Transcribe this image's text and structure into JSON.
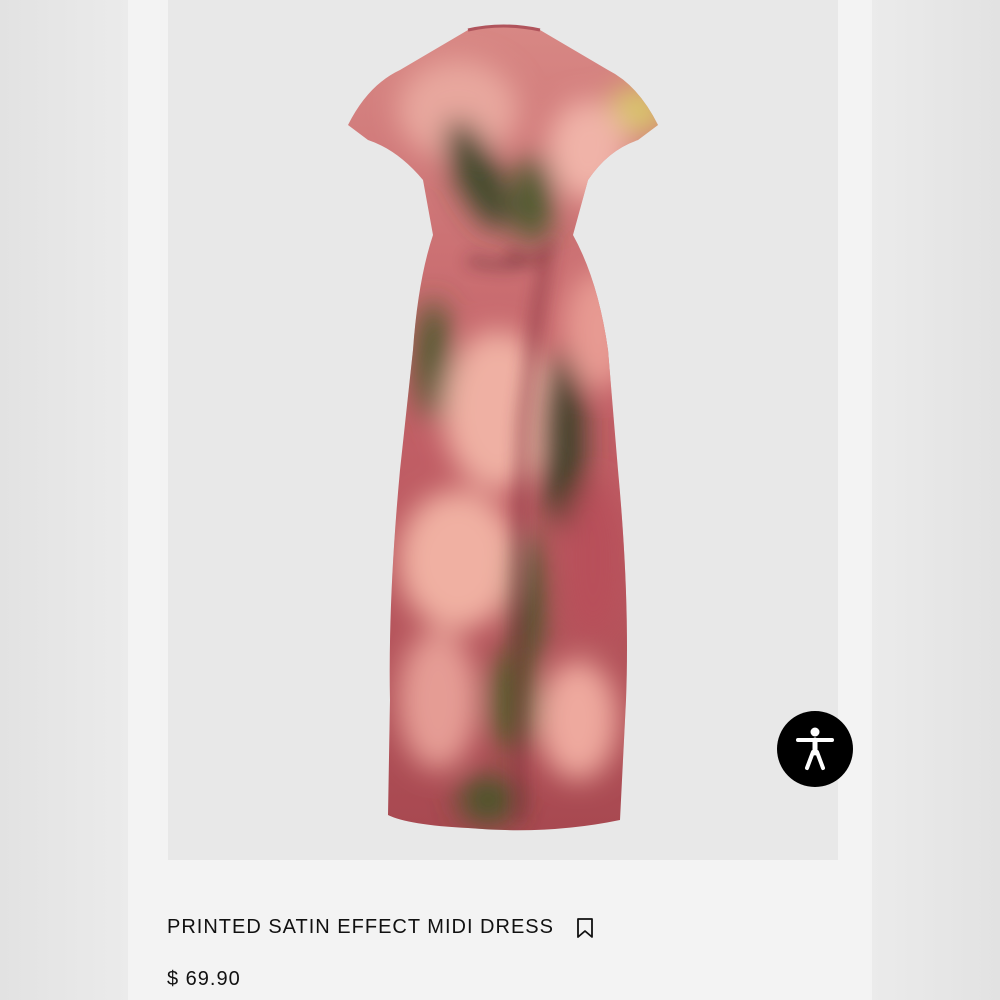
{
  "product": {
    "title": "PRINTED SATIN EFFECT MIDI DRESS",
    "price": "$ 69.90",
    "image": {
      "description_icon": "dress-photo"
    }
  },
  "icons": {
    "bookmark": "bookmark-icon",
    "accessibility": "accessibility-icon"
  },
  "colors": {
    "background": "#ececec",
    "image_background": "#e8e8e8",
    "dress_base": "#c25f66",
    "accessibility_button": "#000000",
    "text": "#111111"
  }
}
